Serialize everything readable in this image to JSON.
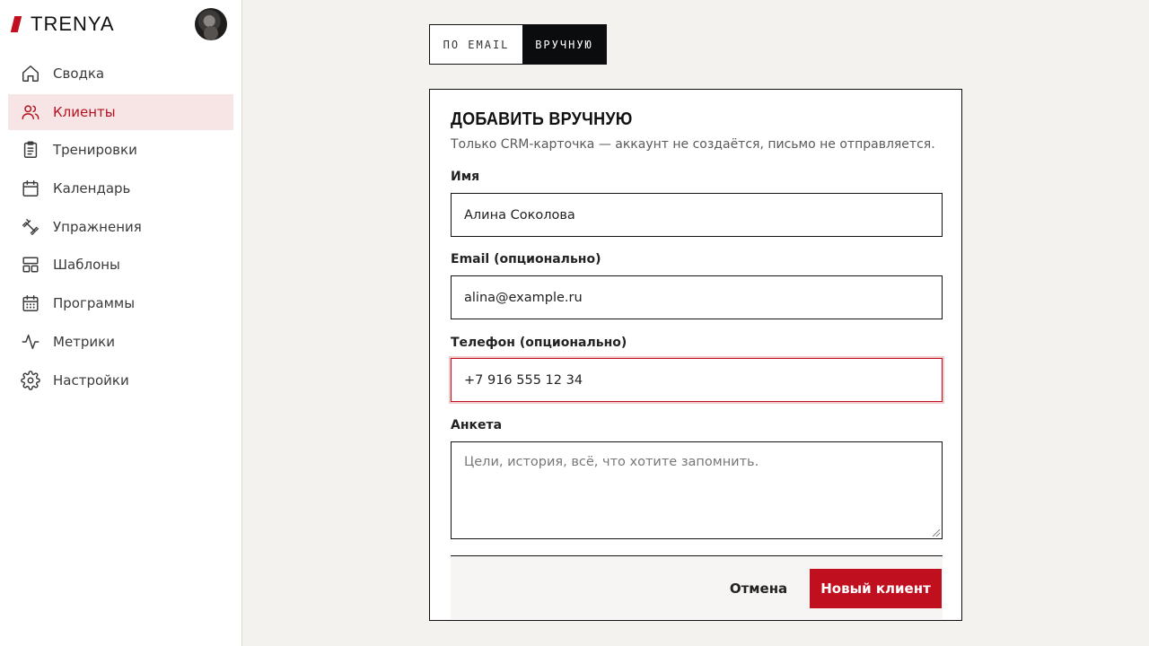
{
  "brand": {
    "name": "TRENYA",
    "accent": "#c0101f"
  },
  "sidebar": {
    "items": [
      {
        "label": "Сводка",
        "icon": "home-icon"
      },
      {
        "label": "Клиенты",
        "icon": "users-icon",
        "active": true
      },
      {
        "label": "Тренировки",
        "icon": "clipboard-list-icon"
      },
      {
        "label": "Календарь",
        "icon": "calendar-icon"
      },
      {
        "label": "Упражнения",
        "icon": "dumbbell-icon"
      },
      {
        "label": "Шаблоны",
        "icon": "layout-icon"
      },
      {
        "label": "Программы",
        "icon": "calendar-grid-icon"
      },
      {
        "label": "Метрики",
        "icon": "activity-icon"
      },
      {
        "label": "Настройки",
        "icon": "gear-icon"
      }
    ]
  },
  "tabs": {
    "email": "ПО EMAIL",
    "manual": "ВРУЧНУЮ",
    "active": "manual"
  },
  "form": {
    "title": "ДОБАВИТЬ ВРУЧНУЮ",
    "subtitle": "Только CRM-карточка — аккаунт не создаётся, письмо не отправляется.",
    "name_label": "Имя",
    "name_value": "Алина Соколова",
    "email_label": "Email (опционально)",
    "email_value": "alina@example.ru",
    "phone_label": "Телефон (опционально)",
    "phone_value": "+7 916 555 12 34",
    "notes_label": "Анкета",
    "notes_placeholder": "Цели, история, всё, что хотите запомнить.",
    "cancel_label": "Отмена",
    "submit_label": "Новый клиент"
  }
}
